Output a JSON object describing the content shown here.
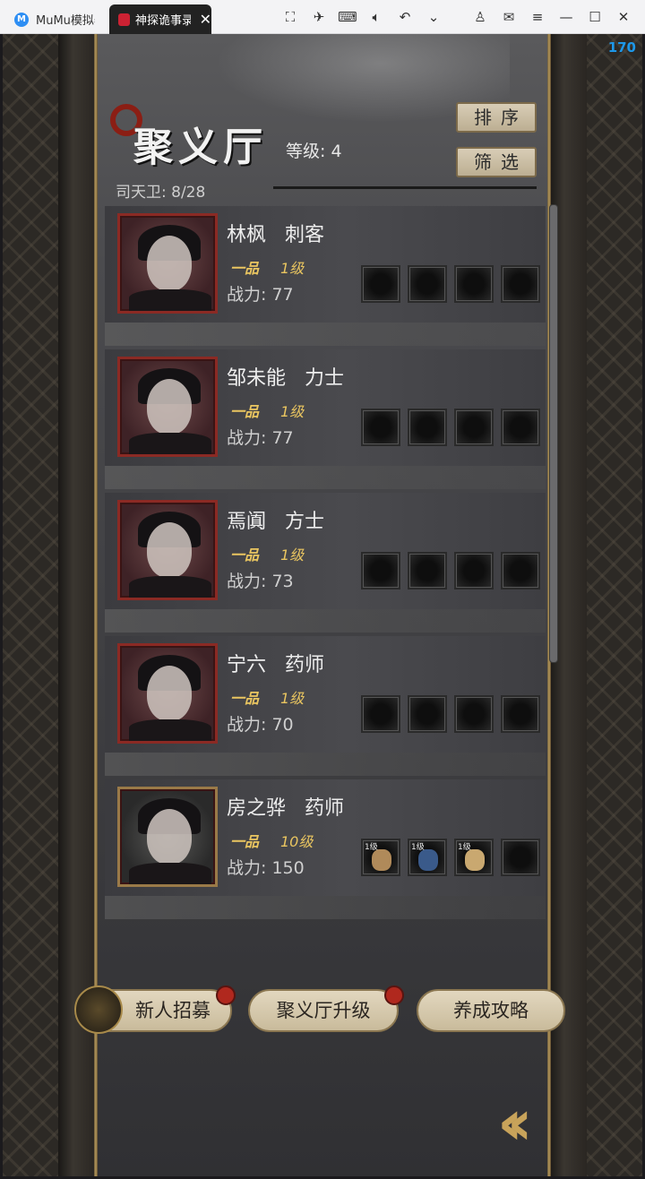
{
  "emulator": {
    "app_tab_title": "MuMu模拟器",
    "game_tab_title": "神探诡事录",
    "fps": "170"
  },
  "hall": {
    "title": "聚义厅",
    "level_label": "等级: 4",
    "guard_count": "司天卫: 8/28",
    "sort_label": "排序",
    "filter_label": "筛选"
  },
  "heroes": [
    {
      "name": "林枫   刺客",
      "rank": "一品",
      "level": "1级",
      "power": "战力: 77",
      "frame": "red",
      "slots": [
        {
          "level": ""
        },
        {
          "level": ""
        },
        {
          "level": ""
        },
        {
          "level": ""
        }
      ]
    },
    {
      "name": "邹未能   力士",
      "rank": "一品",
      "level": "1级",
      "power": "战力: 77",
      "frame": "red",
      "slots": [
        {
          "level": ""
        },
        {
          "level": ""
        },
        {
          "level": ""
        },
        {
          "level": ""
        }
      ]
    },
    {
      "name": "焉阗   方士",
      "rank": "一品",
      "level": "1级",
      "power": "战力: 73",
      "frame": "red",
      "slots": [
        {
          "level": ""
        },
        {
          "level": ""
        },
        {
          "level": ""
        },
        {
          "level": ""
        }
      ]
    },
    {
      "name": "宁六   药师",
      "rank": "一品",
      "level": "1级",
      "power": "战力: 70",
      "frame": "red",
      "slots": [
        {
          "level": ""
        },
        {
          "level": ""
        },
        {
          "level": ""
        },
        {
          "level": ""
        }
      ]
    },
    {
      "name": "房之骅   药师",
      "rank": "一品",
      "level": "10级",
      "power": "战力: 150",
      "frame": "gold",
      "slots": [
        {
          "level": "1级",
          "color": "#b08a5a"
        },
        {
          "level": "1级",
          "color": "#3a5a8a"
        },
        {
          "level": "1级",
          "color": "#c9a870"
        },
        {
          "level": ""
        }
      ]
    }
  ],
  "bottom": {
    "recruit": "新人招募",
    "upgrade": "聚义厅升级",
    "guide": "养成攻略"
  }
}
